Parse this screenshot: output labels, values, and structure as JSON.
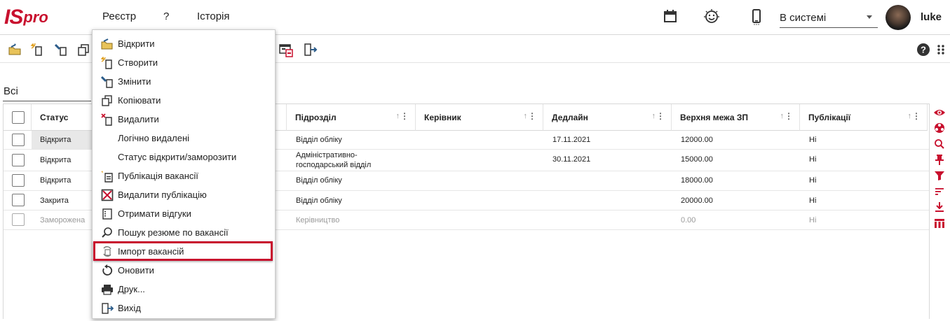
{
  "app": {
    "logo": {
      "is": "IS",
      "pro": "pro"
    },
    "menu": [
      "Реєстр",
      "?",
      "Історія"
    ],
    "status_value": "В системі",
    "user_name": "luke"
  },
  "filter": {
    "label": "Всі"
  },
  "table": {
    "columns": [
      "Статус",
      "Підрозділ",
      "Керівник",
      "Дедлайн",
      "Верхня межа ЗП",
      "Публікації"
    ],
    "rows": [
      {
        "status": "Відкрита",
        "dept": "Відділ обліку",
        "manager": "",
        "deadline": "17.11.2021",
        "salary": "12000.00",
        "pub": "Ні"
      },
      {
        "status": "Відкрита",
        "dept": "Адміністративно-господарський відділ",
        "dept_l1": "Адміністративно-",
        "dept_l2": "господарський відділ",
        "manager": "",
        "deadline": "30.11.2021",
        "salary": "15000.00",
        "pub": "Ні"
      },
      {
        "status": "Відкрита",
        "dept": "Відділ обліку",
        "manager": "",
        "deadline": "",
        "salary": "18000.00",
        "pub": "Ні"
      },
      {
        "status": "Закрита",
        "dept": "Відділ обліку",
        "manager": "",
        "deadline": "",
        "salary": "20000.00",
        "pub": "Ні"
      },
      {
        "status": "Заморожена",
        "dept": "Керівництво",
        "manager": "",
        "deadline": "",
        "salary": "0.00",
        "pub": "Ні"
      }
    ]
  },
  "context_menu": {
    "items": [
      {
        "label": "Відкрити",
        "icon": "open-folder-icon"
      },
      {
        "label": "Створити",
        "icon": "create-icon"
      },
      {
        "label": "Змінити",
        "icon": "edit-icon"
      },
      {
        "label": "Копіювати",
        "icon": "copy-icon"
      },
      {
        "label": "Видалити",
        "icon": "delete-icon"
      },
      {
        "label": "Логічно видалені",
        "icon": ""
      },
      {
        "label": "Статус відкрити/заморозити",
        "icon": ""
      },
      {
        "label": "Публікація вакансії",
        "icon": "publish-icon"
      },
      {
        "label": "Видалити публікацію",
        "icon": "delete-publication-icon"
      },
      {
        "label": "Отримати відгуки",
        "icon": "responses-icon"
      },
      {
        "label": "Пошук резюме по вакансії",
        "icon": "search-icon"
      },
      {
        "label": "Імпорт вакансій",
        "icon": "import-icon"
      },
      {
        "label": "Оновити",
        "icon": "refresh-icon"
      },
      {
        "label": "Друк...",
        "icon": "print-icon"
      },
      {
        "label": "Вихід",
        "icon": "exit-icon"
      }
    ],
    "highlighted": "Імпорт вакансій"
  },
  "colors": {
    "brand": "#c8102e",
    "highlight_border": "#c8102e"
  }
}
